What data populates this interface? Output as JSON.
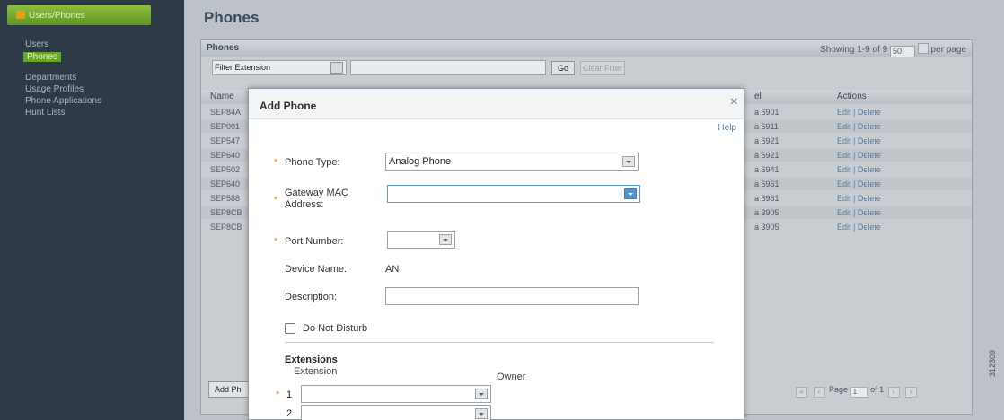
{
  "sidebar": {
    "header": "Users/Phones",
    "items": [
      "Users",
      "Phones",
      "Departments",
      "Usage Profiles",
      "Phone Applications",
      "Hunt Lists"
    ]
  },
  "page": {
    "title": "Phones",
    "panel_title": "Phones",
    "showing": "Showing 1-9 of 9",
    "per_page_value": "50",
    "per_page_label": "per page",
    "filter_label": "Filter",
    "filter_value": "Extension",
    "go": "Go",
    "clear_filter": "Clear Filter",
    "columns": {
      "name": "Name",
      "model": "el",
      "actions": "Actions"
    },
    "rows": [
      {
        "name": "SEP84A",
        "model": "a 6901",
        "actions": "Edit | Delete"
      },
      {
        "name": "SEP001",
        "model": "a 6911",
        "actions": "Edit | Delete"
      },
      {
        "name": "SEP547",
        "model": "a 6921",
        "actions": "Edit | Delete"
      },
      {
        "name": "SEP640",
        "model": "a 6921",
        "actions": "Edit | Delete"
      },
      {
        "name": "SEP502",
        "model": "a 6941",
        "actions": "Edit | Delete"
      },
      {
        "name": "SEP640",
        "model": "a 6961",
        "actions": "Edit | Delete"
      },
      {
        "name": "SEP588",
        "model": "a 6961",
        "actions": "Edit | Delete"
      },
      {
        "name": "SEP8CB",
        "model": "a 3905",
        "actions": "Edit | Delete"
      },
      {
        "name": "SEP8CB",
        "model": "a 3905",
        "actions": "Edit | Delete"
      }
    ],
    "add_button": "Add Ph",
    "pager": {
      "page_label": "Page",
      "page_value": "1",
      "of_label": "of 1"
    }
  },
  "modal": {
    "title": "Add Phone",
    "close": "×",
    "help": "Help",
    "phone_type_label": "Phone Type:",
    "phone_type_value": "Analog Phone",
    "gateway_mac_label_1": "Gateway MAC",
    "gateway_mac_label_2": "Address:",
    "port_number_label": "Port Number:",
    "device_name_label": "Device Name:",
    "device_name_value": "AN",
    "description_label": "Description:",
    "dnd_label": "Do Not Disturb",
    "extensions_title": "Extensions",
    "col_extension": "Extension",
    "col_owner": "Owner",
    "row1": "1",
    "row2": "2",
    "required_mark": "*"
  },
  "watermark": "312309",
  "colors": {
    "sidebar_bg": "#2e3a48",
    "sidebar_active": "#6aa52a",
    "accent_link": "#4f7fae",
    "required": "#e68a1e"
  }
}
